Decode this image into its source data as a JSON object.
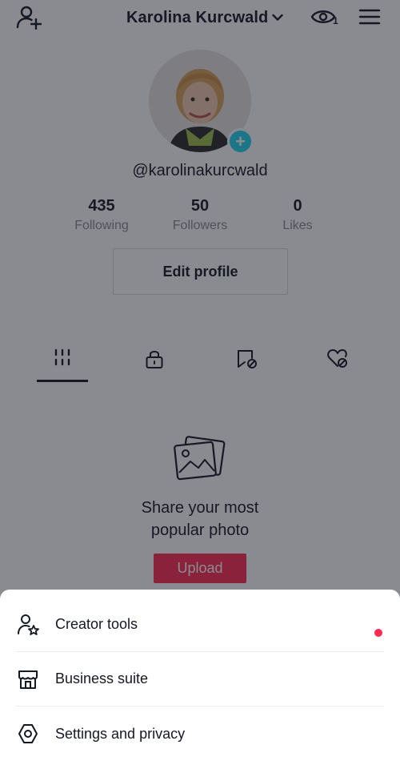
{
  "header": {
    "profile_name": "Karolina Kurcwald",
    "views_count": "1"
  },
  "profile": {
    "username": "@karolinakurcwald",
    "stats": [
      {
        "value": "435",
        "label": "Following"
      },
      {
        "value": "50",
        "label": "Followers"
      },
      {
        "value": "0",
        "label": "Likes"
      }
    ],
    "edit_label": "Edit profile"
  },
  "tabs": [
    {
      "icon": "grid-icon",
      "active": true
    },
    {
      "icon": "lock-icon",
      "active": false
    },
    {
      "icon": "bookmark-icon",
      "active": false
    },
    {
      "icon": "heart-icon",
      "active": false
    }
  ],
  "empty_state": {
    "title_line1": "Share your most",
    "title_line2": "popular photo",
    "upload_label": "Upload"
  },
  "sheet": {
    "items": [
      {
        "label": "Creator tools",
        "icon": "creator-tools-icon",
        "has_dot": true
      },
      {
        "label": "Business suite",
        "icon": "store-icon",
        "has_dot": false
      },
      {
        "label": "Settings and privacy",
        "icon": "gear-icon",
        "has_dot": false
      }
    ]
  },
  "colors": {
    "accent": "#fe2c55",
    "add_badge": "#20d5ec",
    "text": "#161823",
    "muted": "#8a8b91"
  }
}
